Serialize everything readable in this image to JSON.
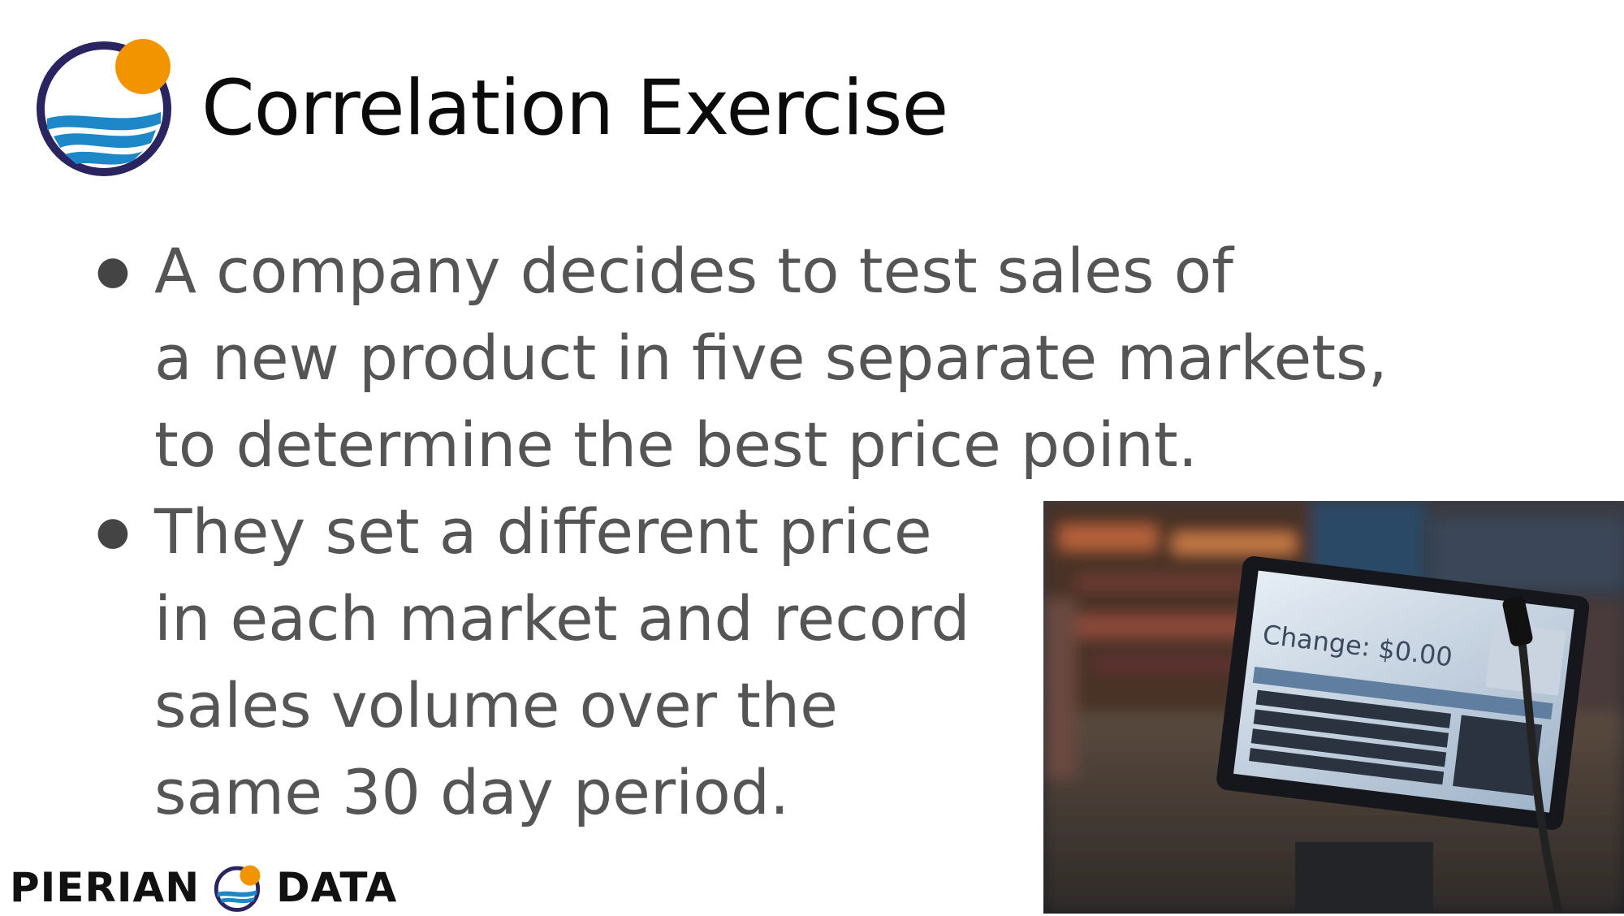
{
  "slide": {
    "title": "Correlation Exercise",
    "bullets": [
      {
        "lines": [
          "A company decides to test sales of",
          "a new product in five separate markets,",
          "to determine the best price point."
        ]
      },
      {
        "lines": [
          "They set a different price",
          "in each market and record",
          "sales volume over the",
          "same 30 day period."
        ]
      }
    ]
  },
  "footer": {
    "brand_left": "PIERIAN",
    "brand_right": "DATA"
  },
  "photo": {
    "screen_text": "Change: $0.00",
    "icon": "pos-terminal-photo"
  },
  "colors": {
    "title": "#0b0b0b",
    "body_text": "#555555",
    "logo_ring": "#2a2460",
    "logo_sun": "#f29400",
    "logo_water": "#1e87c8"
  }
}
